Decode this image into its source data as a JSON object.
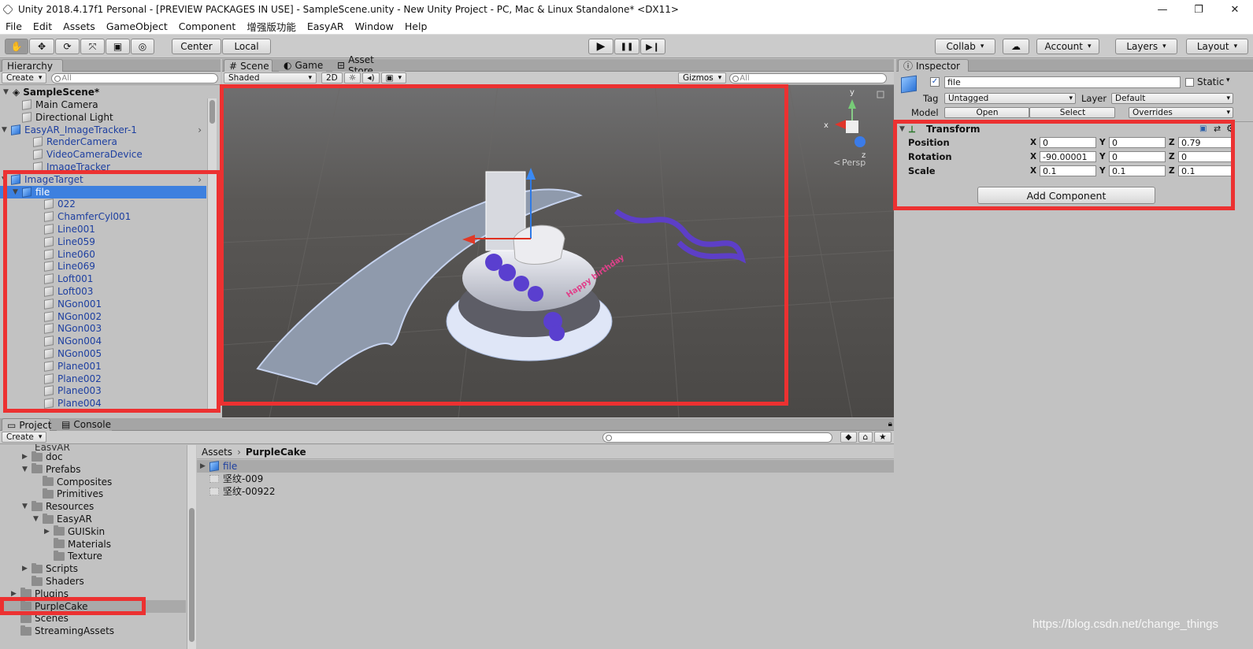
{
  "window": {
    "title": "Unity 2018.4.17f1 Personal - [PREVIEW PACKAGES IN USE] - SampleScene.unity - New Unity Project - PC, Mac & Linux Standalone* <DX11>",
    "minimize": "—",
    "restore": "❐",
    "close": "✕"
  },
  "menu": [
    "File",
    "Edit",
    "Assets",
    "GameObject",
    "Component",
    "增强版功能",
    "EasyAR",
    "Window",
    "Help"
  ],
  "toolbar": {
    "tools": [
      "hand-tool-icon",
      "move-tool-icon",
      "rotate-tool-icon",
      "scale-tool-icon",
      "rect-tool-icon",
      "transform-tool-icon"
    ],
    "tool_glyphs": [
      "✋",
      "✥",
      "⟳",
      "⤧",
      "▣",
      "◎"
    ],
    "pivot": "Center",
    "space": "Local",
    "play": "▶",
    "pause": "❚❚",
    "step": "▶❙",
    "collab": "Collab",
    "cloud": "☁",
    "account": "Account",
    "layers": "Layers",
    "layout": "Layout"
  },
  "hierarchy": {
    "tab": "Hierarchy",
    "create": "Create",
    "search_placeholder": "All",
    "scene": "SampleScene*",
    "items": [
      {
        "label": "Main Camera",
        "depth": 1,
        "blue": false,
        "arrow": ""
      },
      {
        "label": "Directional Light",
        "depth": 1,
        "blue": false,
        "arrow": ""
      },
      {
        "label": "EasyAR_ImageTracker-1",
        "depth": 0,
        "blue": true,
        "arrow": "▼"
      },
      {
        "label": "RenderCamera",
        "depth": 2,
        "blue": false,
        "arrow": ""
      },
      {
        "label": "VideoCameraDevice",
        "depth": 2,
        "blue": false,
        "arrow": ""
      },
      {
        "label": "ImageTracker",
        "depth": 2,
        "blue": false,
        "arrow": ""
      },
      {
        "label": "ImageTarget",
        "depth": 0,
        "blue": true,
        "arrow": "▼"
      },
      {
        "label": "file",
        "depth": 1,
        "blue": true,
        "arrow": "▼",
        "selected": true
      },
      {
        "label": "022",
        "depth": 3,
        "blue": false,
        "arrow": ""
      },
      {
        "label": "ChamferCyl001",
        "depth": 3,
        "blue": false,
        "arrow": ""
      },
      {
        "label": "Line001",
        "depth": 3,
        "blue": false,
        "arrow": ""
      },
      {
        "label": "Line059",
        "depth": 3,
        "blue": false,
        "arrow": ""
      },
      {
        "label": "Line060",
        "depth": 3,
        "blue": false,
        "arrow": ""
      },
      {
        "label": "Line069",
        "depth": 3,
        "blue": false,
        "arrow": ""
      },
      {
        "label": "Loft001",
        "depth": 3,
        "blue": false,
        "arrow": ""
      },
      {
        "label": "Loft003",
        "depth": 3,
        "blue": false,
        "arrow": ""
      },
      {
        "label": "NGon001",
        "depth": 3,
        "blue": false,
        "arrow": ""
      },
      {
        "label": "NGon002",
        "depth": 3,
        "blue": false,
        "arrow": ""
      },
      {
        "label": "NGon003",
        "depth": 3,
        "blue": false,
        "arrow": ""
      },
      {
        "label": "NGon004",
        "depth": 3,
        "blue": false,
        "arrow": ""
      },
      {
        "label": "NGon005",
        "depth": 3,
        "blue": false,
        "arrow": ""
      },
      {
        "label": "Plane001",
        "depth": 3,
        "blue": false,
        "arrow": ""
      },
      {
        "label": "Plane002",
        "depth": 3,
        "blue": false,
        "arrow": ""
      },
      {
        "label": "Plane003",
        "depth": 3,
        "blue": false,
        "arrow": ""
      },
      {
        "label": "Plane004",
        "depth": 3,
        "blue": false,
        "arrow": ""
      }
    ]
  },
  "scene": {
    "tabs": [
      "Scene",
      "Game",
      "Asset Store"
    ],
    "shading": "Shaded",
    "mode2d": "2D",
    "gizmos": "Gizmos",
    "search_placeholder": "All",
    "persp": "Persp",
    "gizmo_x": "x",
    "gizmo_y": "y",
    "gizmo_z": "z",
    "cake_text": "Happy birthday"
  },
  "inspector": {
    "tab": "Inspector",
    "name": "file",
    "static": "Static",
    "tag_label": "Tag",
    "tag": "Untagged",
    "layer_label": "Layer",
    "layer": "Default",
    "model_label": "Model",
    "open": "Open",
    "select": "Select",
    "overrides": "Overrides",
    "transform": "Transform",
    "position": {
      "label": "Position",
      "x": "0",
      "y": "0",
      "z": "0.79"
    },
    "rotation": {
      "label": "Rotation",
      "x": "-90.00001",
      "y": "0",
      "z": "0"
    },
    "scale": {
      "label": "Scale",
      "x": "0.1",
      "y": "0.1",
      "z": "0.1"
    },
    "add_component": "Add Component"
  },
  "project": {
    "tabs": [
      "Project",
      "Console"
    ],
    "create": "Create",
    "breadcrumb_root": "Assets",
    "breadcrumb_current": "PurpleCake",
    "tree_cutoff": "EasyAR",
    "tree": [
      {
        "label": "doc",
        "depth": 1,
        "arrow": "▶"
      },
      {
        "label": "Prefabs",
        "depth": 1,
        "arrow": "▼"
      },
      {
        "label": "Composites",
        "depth": 2,
        "arrow": ""
      },
      {
        "label": "Primitives",
        "depth": 2,
        "arrow": ""
      },
      {
        "label": "Resources",
        "depth": 1,
        "arrow": "▼"
      },
      {
        "label": "EasyAR",
        "depth": 2,
        "arrow": "▼"
      },
      {
        "label": "GUISkin",
        "depth": 3,
        "arrow": "▶"
      },
      {
        "label": "Materials",
        "depth": 3,
        "arrow": ""
      },
      {
        "label": "Texture",
        "depth": 3,
        "arrow": ""
      },
      {
        "label": "Scripts",
        "depth": 1,
        "arrow": "▶"
      },
      {
        "label": "Shaders",
        "depth": 1,
        "arrow": ""
      },
      {
        "label": "Plugins",
        "depth": 0,
        "arrow": "▶"
      },
      {
        "label": "PurpleCake",
        "depth": 0,
        "arrow": "",
        "selected": true
      },
      {
        "label": "Scenes",
        "depth": 0,
        "arrow": ""
      },
      {
        "label": "StreamingAssets",
        "depth": 0,
        "arrow": ""
      }
    ],
    "assets": [
      {
        "label": "file",
        "type": "prefab"
      },
      {
        "label": "坚纹-009",
        "type": "texture"
      },
      {
        "label": "坚纹-00922",
        "type": "texture"
      }
    ]
  },
  "watermark": "https://blog.csdn.net/change_things",
  "colors": {
    "highlight": "#ec3131",
    "selection": "#3d80df",
    "blue_text": "#1d3fa0"
  }
}
